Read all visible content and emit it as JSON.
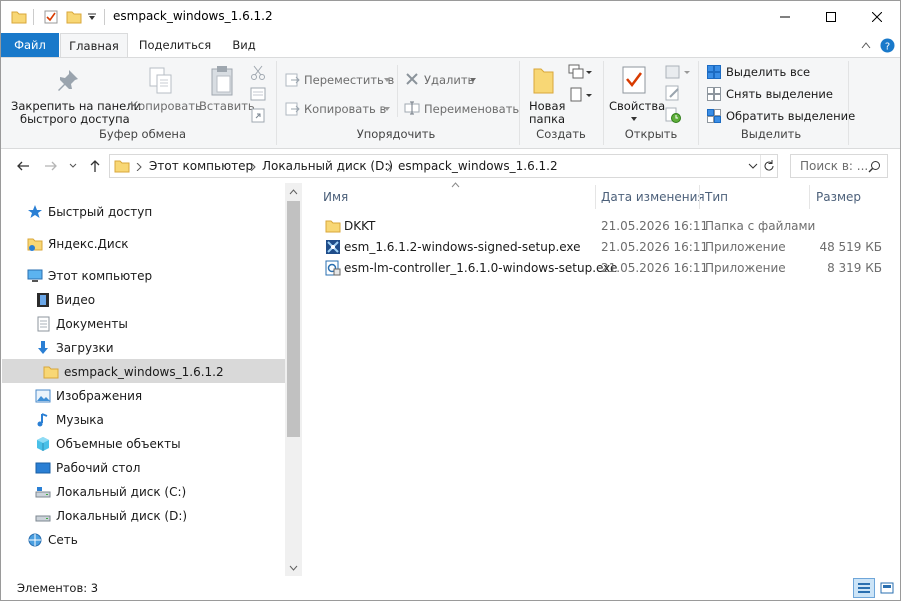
{
  "window": {
    "title": "esmpack_windows_1.6.1.2"
  },
  "tabs": {
    "file": "Файл",
    "home": "Главная",
    "share": "Поделиться",
    "view": "Вид"
  },
  "ribbon": {
    "pin": {
      "line1": "Закрепить на панели",
      "line2": "быстрого доступа"
    },
    "copy": "Копировать",
    "paste": "Вставить",
    "clipboard_group": "Буфер обмена",
    "move_to": "Переместить в",
    "copy_to": "Копировать в",
    "delete": "Удалить",
    "rename": "Переименовать",
    "organize_group": "Упорядочить",
    "new_folder": {
      "line1": "Новая",
      "line2": "папка"
    },
    "create_group": "Создать",
    "properties": "Свойства",
    "open_group": "Открыть",
    "select_all": "Выделить все",
    "select_none": "Снять выделение",
    "invert_selection": "Обратить выделение",
    "select_group": "Выделить"
  },
  "address": {
    "crumbs": [
      "Этот компьютер",
      "Локальный диск (D:)",
      "esmpack_windows_1.6.1.2"
    ],
    "search_placeholder": "Поиск в: ..."
  },
  "nav": {
    "quick_access": "Быстрый доступ",
    "yandex_disk": "Яндекс.Диск",
    "this_pc": "Этот компьютер",
    "video": "Видео",
    "documents": "Документы",
    "downloads": "Загрузки",
    "selected_folder": "esmpack_windows_1.6.1.2",
    "images": "Изображения",
    "music": "Музыка",
    "objects3d": "Объемные объекты",
    "desktop": "Рабочий стол",
    "disk_c": "Локальный диск (C:)",
    "disk_d": "Локальный диск (D:)",
    "network": "Сеть"
  },
  "columns": {
    "name": "Имя",
    "date": "Дата изменения",
    "type": "Тип",
    "size": "Размер"
  },
  "files": [
    {
      "name": "DKKT",
      "date": "21.05.2026 16:11",
      "type": "Папка с файлами",
      "size": ""
    },
    {
      "name": "esm_1.6.1.2-windows-signed-setup.exe",
      "date": "21.05.2026 16:11",
      "type": "Приложение",
      "size": "48 519 КБ"
    },
    {
      "name": "esm-lm-controller_1.6.1.0-windows-setup.exe",
      "date": "21.05.2026 16:11",
      "type": "Приложение",
      "size": "8 319 КБ"
    }
  ],
  "status": {
    "items": "Элементов: 3"
  },
  "colors": {
    "accent": "#1979ca",
    "folder": "#f8d775",
    "selection": "#d9d9d9",
    "header_text": "#4c607a"
  }
}
